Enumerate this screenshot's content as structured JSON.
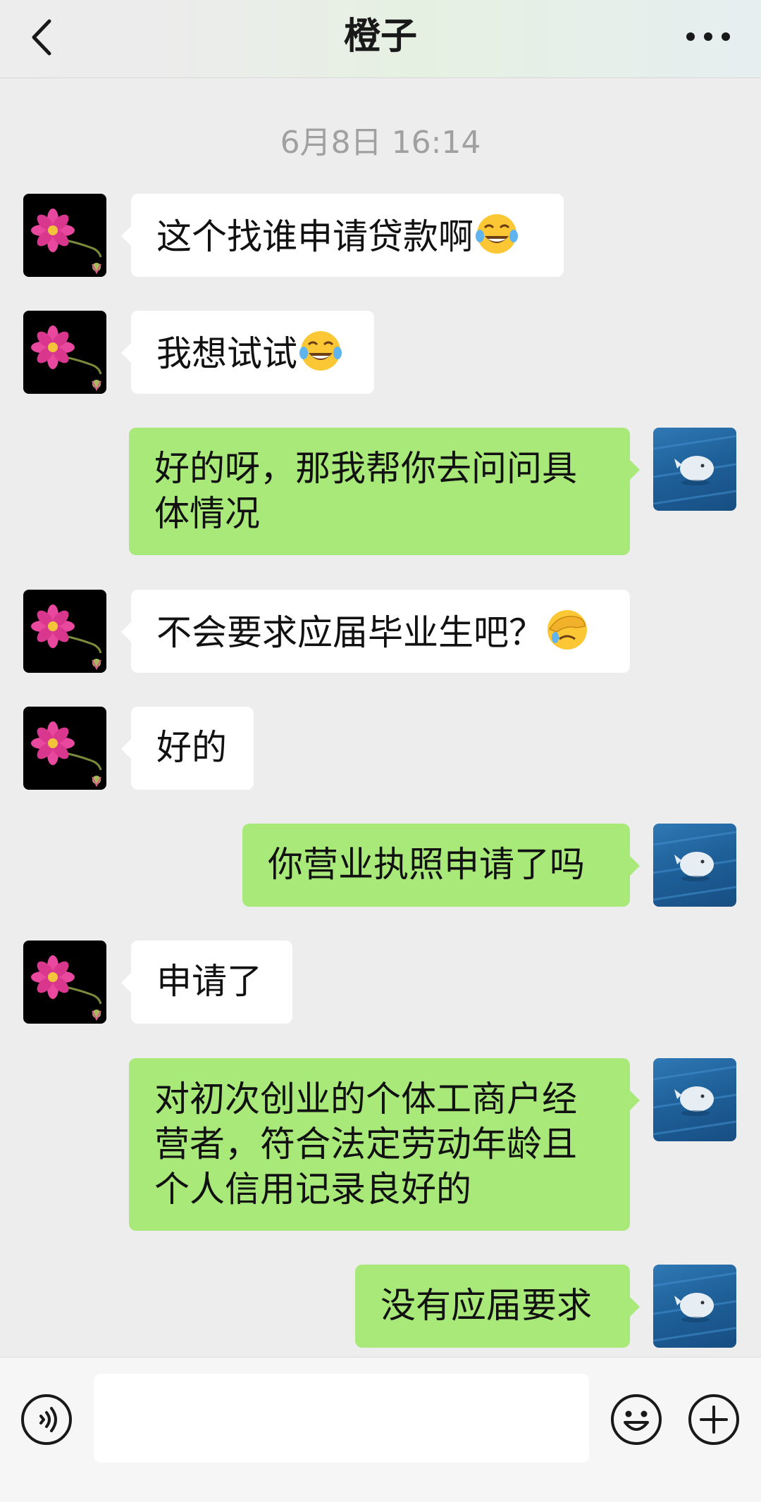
{
  "header": {
    "title": "橙子"
  },
  "timestamp": "6月8日 16:14",
  "messages": [
    {
      "side": "in",
      "text": "这个找谁申请贷款啊",
      "emoji": "laughing-tears-emoji"
    },
    {
      "side": "in",
      "text": "我想试试",
      "emoji": "laughing-tears-emoji"
    },
    {
      "side": "out",
      "lines": [
        "好的呀，那我帮你去问问具",
        "体情况"
      ]
    },
    {
      "side": "in",
      "text": "不会要求应届毕业生吧？",
      "emoji": "facepalm-cry-emoji"
    },
    {
      "side": "in",
      "text": "好的"
    },
    {
      "side": "out",
      "text": "你营业执照申请了吗"
    },
    {
      "side": "in",
      "text": "申请了"
    },
    {
      "side": "out",
      "lines": [
        "对初次创业的个体工商户经",
        "营者，符合法定劳动年龄且",
        "个人信用记录良好的"
      ]
    },
    {
      "side": "out",
      "text": "没有应届要求"
    }
  ],
  "input": {
    "value": "",
    "placeholder": ""
  },
  "icons": {
    "back": "chevron-left-icon",
    "more": "more-dots-icon",
    "voice": "voice-icon",
    "emoji": "emoji-icon",
    "plus": "plus-icon"
  },
  "colors": {
    "incoming_bubble": "#ffffff",
    "outgoing_bubble": "#a9e97a",
    "background": "#ededed"
  }
}
